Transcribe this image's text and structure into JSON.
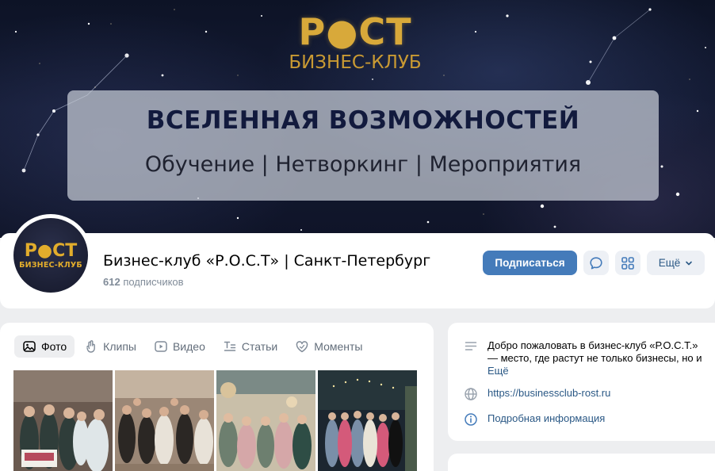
{
  "cover": {
    "logo_main": "Р●СТ",
    "logo_sub": "БИЗНЕС-КЛУБ",
    "banner_title": "ВСЕЛЕННАЯ ВОЗМОЖНОСТЕЙ",
    "banner_subtitle": "Обучение | Нетворкинг | Мероприятия"
  },
  "avatar": {
    "main": "Р●СТ",
    "sub": "БИЗНЕС-КЛУБ"
  },
  "header": {
    "group_name": "Бизнес-клуб «Р.О.С.Т» | Санкт-Петербург",
    "subscribers_count": "612",
    "subscribers_label": " подписчиков",
    "subscribe_button": "Подписаться",
    "more_button": "Ещё"
  },
  "media": {
    "tabs": [
      {
        "label": "Фото",
        "icon": "photo-icon",
        "active": true
      },
      {
        "label": "Клипы",
        "icon": "clips-icon",
        "active": false
      },
      {
        "label": "Видео",
        "icon": "video-icon",
        "active": false
      },
      {
        "label": "Статьи",
        "icon": "articles-icon",
        "active": false
      },
      {
        "label": "Моменты",
        "icon": "moments-icon",
        "active": false
      }
    ]
  },
  "info": {
    "description": "Добро пожаловать в бизнес-клуб «Р.О.С.Т.» — место, где растут не только бизнесы, но и",
    "description_more": "Ещё",
    "website": "https://businessclub-rost.ru",
    "details_link": "Подробная информация"
  },
  "colors": {
    "accent": "#447bba",
    "link": "#2a5885",
    "gold": "#d8a93a",
    "page_bg": "#edeef0"
  }
}
